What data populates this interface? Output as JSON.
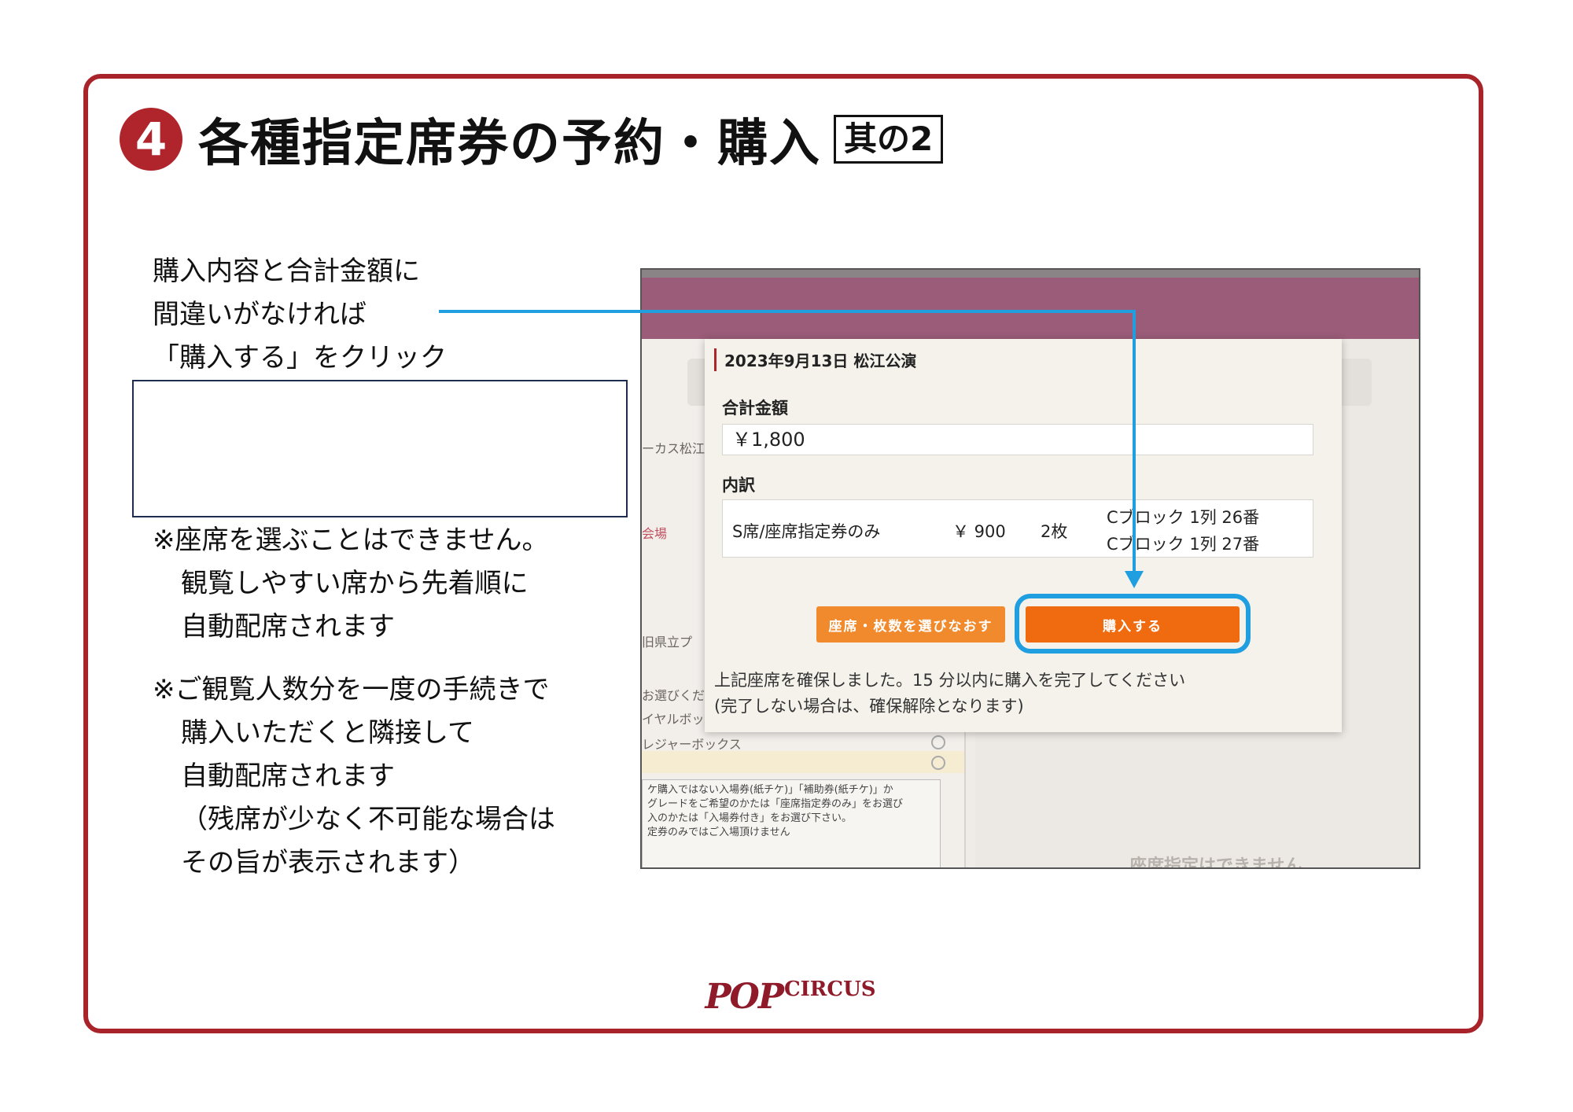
{
  "page": {
    "step_number": "4",
    "title": "各種指定席券の予約・購入",
    "title_tag": "其の2"
  },
  "instructions": {
    "lines": [
      "購入内容と合計金額に",
      "間違いがなければ",
      "「購入する」をクリック"
    ]
  },
  "notes": {
    "note1": [
      "※座席を選ぶことはできません。",
      "観覧しやすい席から先着順に",
      "自動配席されます"
    ],
    "note2": [
      "※ご観覧人数分を一度の手続きで",
      "購入いただくと隣接して",
      "自動配席されます",
      "（残席が少なく不可能な場合は",
      "その旨が表示されます）"
    ]
  },
  "screenshot": {
    "modal": {
      "date_venue": "2023年9月13日 松江公演",
      "total_label": "合計金額",
      "total_value": "￥1,800",
      "breakdown_label": "内訳",
      "item_name": "S席/座席指定券のみ",
      "item_price": "￥ 900",
      "item_qty": "2枚",
      "seat_1": "Cブロック 1列 26番",
      "seat_2": "Cブロック 1列 27番",
      "change_button": "座席・枚数を選びなおす",
      "buy_button": "購入する",
      "message_1": "上記座席を確保しました。15 分以内に購入を完了してください",
      "message_2": "(完了しない場合は、確保解除となります)"
    },
    "background": {
      "frag_circus": "ーカス松江",
      "frag_venue": "会場",
      "frag_hall": "旧県立プ",
      "frag_select": "お選びくだ",
      "frag_royal": "イヤルボック",
      "frag_leisure": "レジャーボックス",
      "note_lines": [
        "ケ購入ではない入場券(紙チケ)」「補助券(紙チケ)」か",
        "グレードをご希望のかたは「座席指定券のみ」をお選び",
        "",
        "入のかたは「入場券付き」をお選び下さい。",
        "定券のみではご入場頂けません"
      ],
      "no_seat_text": "座席指定はできません"
    }
  },
  "logo": {
    "main": "POP",
    "sub": "CIRCUS"
  },
  "colors": {
    "brand_red": "#a8232a",
    "header_purple": "#9a5c78",
    "buy_orange": "#f06a10",
    "highlight_blue": "#1f9fe0"
  }
}
